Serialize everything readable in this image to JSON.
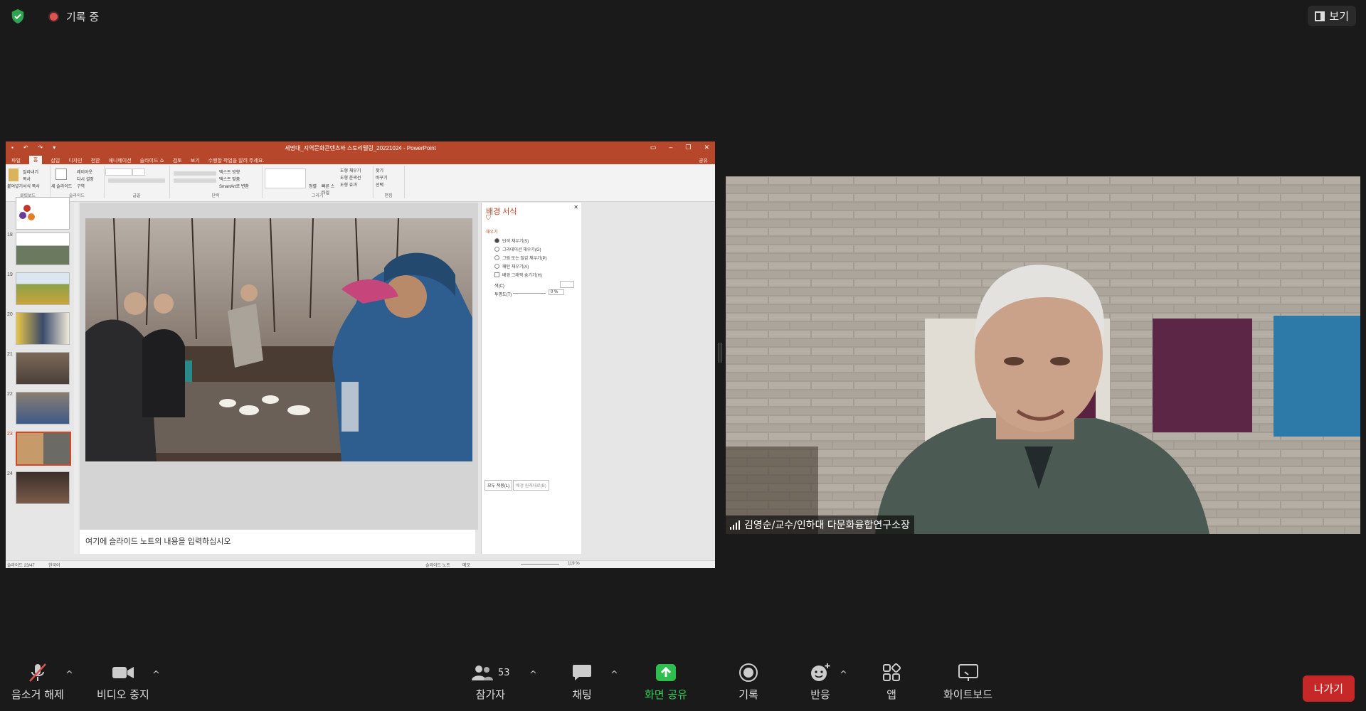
{
  "recording": {
    "label": "기록 중"
  },
  "view": {
    "label": "보기"
  },
  "powerpoint": {
    "window_title": "세명대_지역문화콘텐츠와 스토리텔링_20221024 - PowerPoint",
    "tabs": [
      "파일",
      "홈",
      "삽입",
      "디자인",
      "전환",
      "애니메이션",
      "슬라이드 쇼",
      "검토",
      "보기",
      "수행할 작업을 알려 주세요."
    ],
    "share_tab": "공유",
    "ribbon_groups": [
      "클립보드",
      "슬라이드",
      "글꼴",
      "단락",
      "그리기",
      "편집"
    ],
    "ribbon_items": {
      "paste": "붙여넣기",
      "cut": "잘라내기",
      "copy": "복사",
      "format_copy": "서식 복사",
      "new_slide": "새 슬라이드",
      "layout": "레이아웃",
      "reset": "다시 설정",
      "section": "구역",
      "text_direction": "텍스트 방향",
      "text_align": "텍스트 맞춤",
      "smartart": "SmartArt로 변환",
      "arrange": "정렬",
      "quick_styles": "빠른 스타일",
      "shape_fill": "도형 채우기",
      "shape_outline": "도형 윤곽선",
      "shape_effect": "도형 효과",
      "find": "찾기",
      "replace": "바꾸기",
      "select": "선택"
    },
    "slide_numbers": [
      "18",
      "19",
      "20",
      "21",
      "22",
      "23",
      "24"
    ],
    "notes_placeholder": "여기에 슬라이드 노트의 내용을 입력하십시오",
    "format_pane": {
      "title": "배경 서식",
      "section": "채우기",
      "options": [
        "단색 채우기(S)",
        "그라데이션 채우기(G)",
        "그림 또는 질감 채우기(P)",
        "패턴 채우기(A)",
        "배경 그래픽 숨기기(H)"
      ],
      "color_label": "색(C)",
      "transparency_label": "투명도(T)",
      "transparency_value": "0 %",
      "apply_all": "모두 적용(L)",
      "reset_bg": "배경 원래대로(B)"
    },
    "status": {
      "slide_info": "슬라이드 23/47",
      "language": "한국어",
      "notes": "슬라이드 노트",
      "comments": "메모",
      "zoom": "119 %"
    }
  },
  "participant": {
    "name": "김영순/교수/인하대 다문화융합연구소장"
  },
  "toolbar": {
    "unmute": "음소거 해제",
    "stop_video": "비디오 중지",
    "participants": "참가자",
    "participants_count": "53",
    "chat": "채팅",
    "share_screen": "화면 공유",
    "record": "기록",
    "reactions": "반응",
    "apps": "앱",
    "whiteboard": "화이트보드",
    "leave": "나가기"
  },
  "colors": {
    "background": "#1a1a1a",
    "powerpoint_accent": "#b7472a",
    "share_green": "#34d058",
    "leave_red": "#c62828",
    "shield_green": "#2ea44f"
  }
}
